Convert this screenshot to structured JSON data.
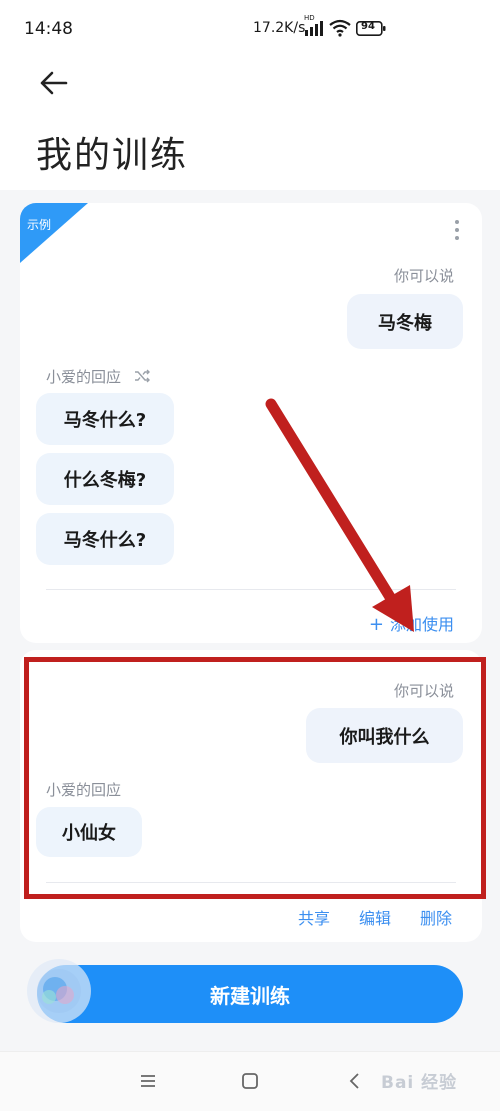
{
  "status_bar": {
    "time": "14:48",
    "network_speed": "17.2K/s",
    "signal_badge": "HD",
    "battery_level": "94"
  },
  "header": {
    "back_icon": "arrow-left-icon",
    "title": "我的训练"
  },
  "example_card": {
    "badge": "示例",
    "say_label": "你可以说",
    "say_text": "马冬梅",
    "reply_label": "小爱的回应",
    "replies": [
      "马冬什么?",
      "什么冬梅?",
      "马冬什么?"
    ],
    "add_action": "添加使用"
  },
  "training_card": {
    "say_label": "你可以说",
    "say_text": "你叫我什么",
    "reply_label": "小爱的回应",
    "reply_text": "小仙女",
    "actions": {
      "share": "共享",
      "edit": "编辑",
      "delete": "删除"
    }
  },
  "new_training_button": "新建训练",
  "nav_bar": {
    "menu_icon": "menu-icon",
    "home_icon": "square-home-icon",
    "back_icon": "triangle-back-icon"
  },
  "watermark": "Bai 经验",
  "colors": {
    "accent": "#1e8ff8",
    "link": "#3c8ff0",
    "annotation_red": "#c0201e",
    "bubble": "#eef3fb"
  }
}
